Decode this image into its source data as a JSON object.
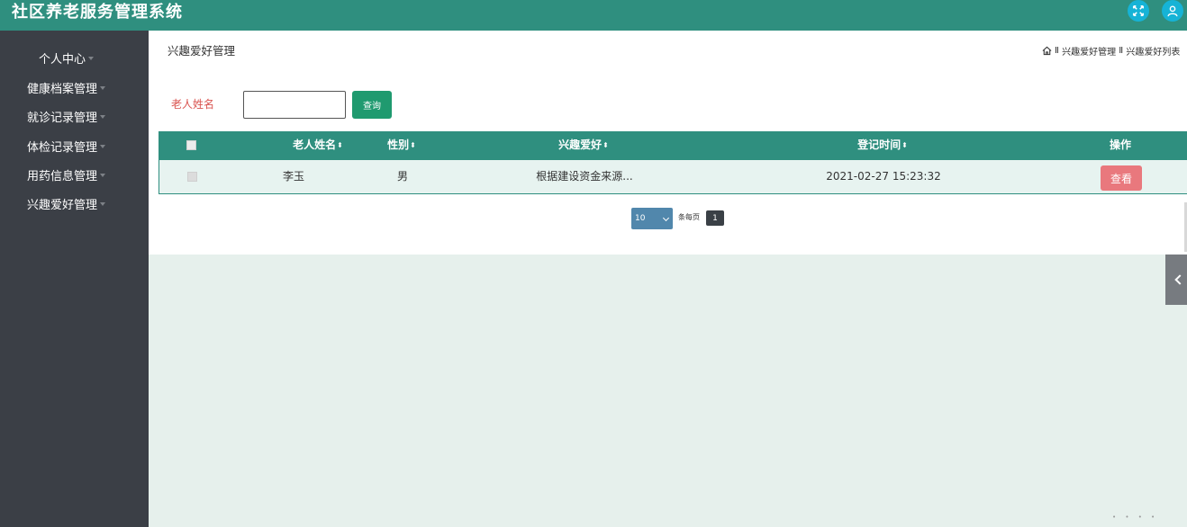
{
  "app": {
    "title": "社区养老服务管理系统"
  },
  "header_icons": [
    "fullscreen-icon",
    "user-icon"
  ],
  "sidebar": {
    "items": [
      {
        "label": "个人中心"
      },
      {
        "label": "健康档案管理"
      },
      {
        "label": "就诊记录管理"
      },
      {
        "label": "体检记录管理"
      },
      {
        "label": "用药信息管理"
      },
      {
        "label": "兴趣爱好管理"
      }
    ]
  },
  "page": {
    "title": "兴趣爱好管理",
    "breadcrumb": [
      "兴趣爱好管理",
      "兴趣爱好列表"
    ],
    "breadcrumb_separator": "Ⅱ"
  },
  "search": {
    "label": "老人姓名",
    "value": "",
    "placeholder": "",
    "button": "查询"
  },
  "table": {
    "sort_glyph": "⬍",
    "columns": [
      {
        "label": "老人姓名",
        "sortable": true
      },
      {
        "label": "性别",
        "sortable": true
      },
      {
        "label": "兴趣爱好",
        "sortable": true
      },
      {
        "label": "登记时间",
        "sortable": true
      },
      {
        "label": "操作",
        "sortable": false
      }
    ],
    "rows": [
      {
        "name": "李玉",
        "gender": "男",
        "hobby": "根据建设资金来源...",
        "time": "2021-02-27 15:23:32",
        "action": "查看"
      }
    ]
  },
  "pagination": {
    "page_size": "10",
    "per_page_label": "条每页",
    "current_page": "1"
  },
  "colors": {
    "topbar": "#2f8f7f",
    "sidebar": "#3b3f46",
    "table_header": "#2f8f7f",
    "search_button": "#1f9a6f",
    "view_button": "#e9787d",
    "label_red": "#d9534f"
  }
}
